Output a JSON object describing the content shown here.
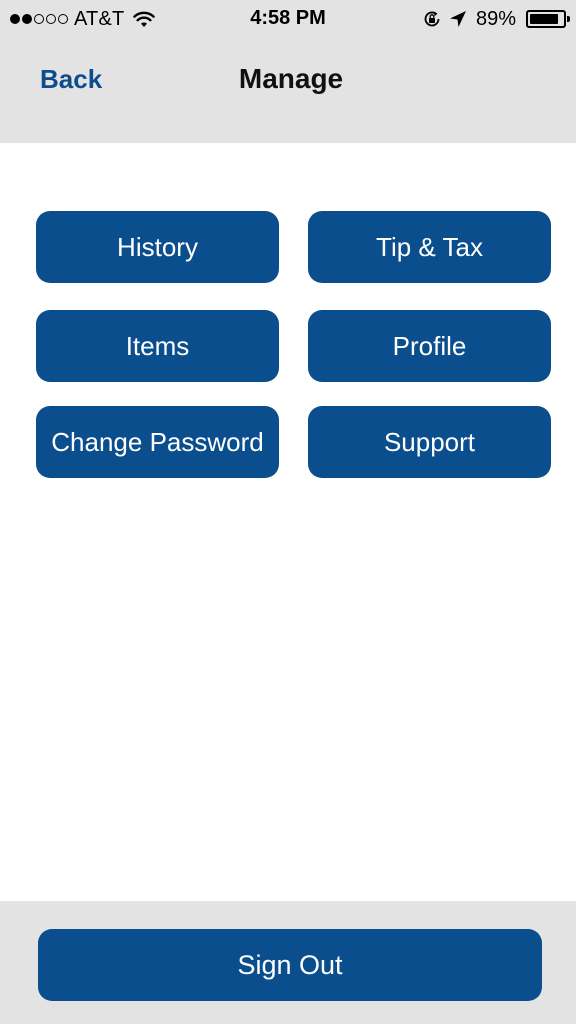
{
  "status_bar": {
    "signal_filled": 2,
    "signal_total": 5,
    "carrier": "AT&T",
    "time": "4:58 PM",
    "battery_percent": "89%",
    "battery_level": 0.89,
    "icons": [
      "wifi-icon",
      "rotation-lock-icon",
      "location-arrow-icon",
      "battery-icon"
    ]
  },
  "nav": {
    "back_label": "Back",
    "title": "Manage"
  },
  "menu": {
    "history": "History",
    "tip_tax": "Tip & Tax",
    "items": "Items",
    "profile": "Profile",
    "change_password": "Change Password",
    "support": "Support"
  },
  "footer": {
    "sign_out": "Sign Out"
  },
  "colors": {
    "header_bg": "#e3e3e4",
    "button_bg": "#0a4e8e",
    "link": "#0d4c8d",
    "button_text": "#ffffff"
  }
}
